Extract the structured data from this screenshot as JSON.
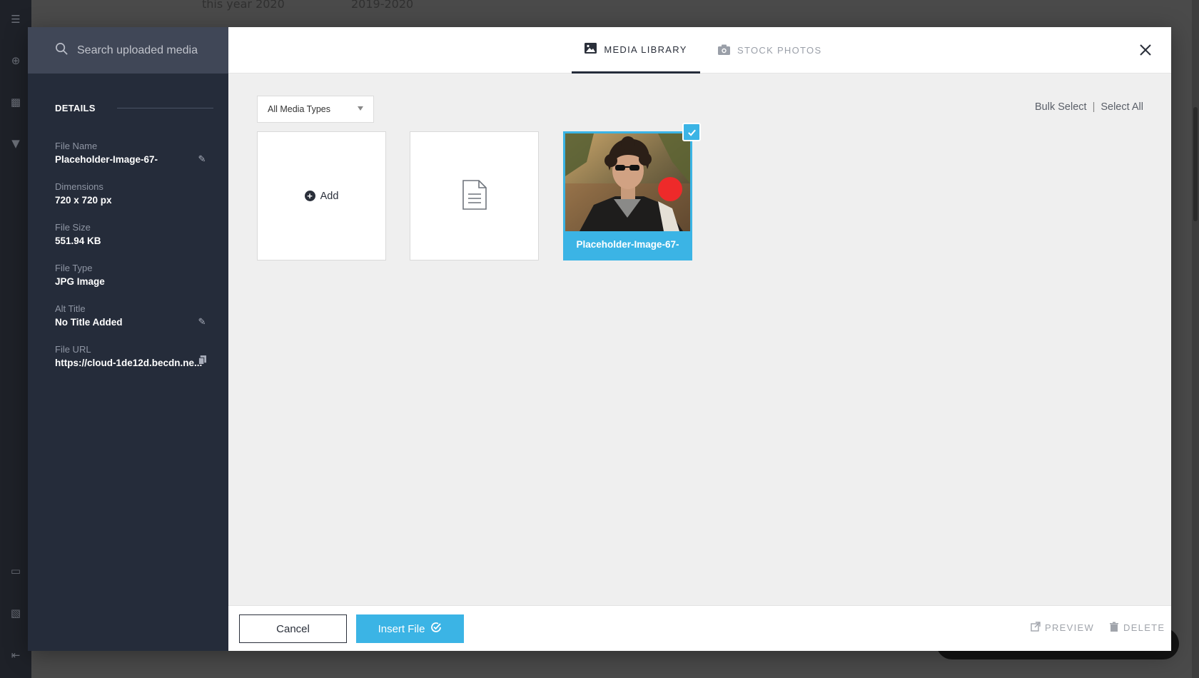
{
  "background": {
    "col1": "this year 2020",
    "col2": "2019-2020"
  },
  "search": {
    "placeholder": "Search uploaded media"
  },
  "details": {
    "title": "DETAILS",
    "fields": [
      {
        "label": "File Name",
        "value": "Placeholder-Image-67-",
        "action": "pencil-icon"
      },
      {
        "label": "Dimensions",
        "value": "720 x 720 px"
      },
      {
        "label": "File Size",
        "value": "551.94 KB"
      },
      {
        "label": "File Type",
        "value": "JPG Image"
      },
      {
        "label": "Alt Title",
        "value": "No Title Added",
        "action": "pencil-icon"
      },
      {
        "label": "File URL",
        "value": "https://cloud-1de12d.becdn.ne...",
        "action": "copy-icon"
      }
    ]
  },
  "tabs": {
    "media_library": "MEDIA LIBRARY",
    "stock_photos": "STOCK PHOTOS",
    "active": "media_library"
  },
  "filter": {
    "selected": "All Media Types"
  },
  "bulk": {
    "bulk_select": "Bulk Select",
    "separator": "|",
    "select_all": "Select All"
  },
  "tiles": {
    "add_label": "Add",
    "selected_caption": "Placeholder-Image-67-"
  },
  "footer": {
    "cancel": "Cancel",
    "insert": "Insert File",
    "preview": "PREVIEW",
    "delete": "DELETE"
  },
  "colors": {
    "accent": "#3bb4e5",
    "panel": "#252c3a",
    "cursor": "#ee2a2a"
  }
}
